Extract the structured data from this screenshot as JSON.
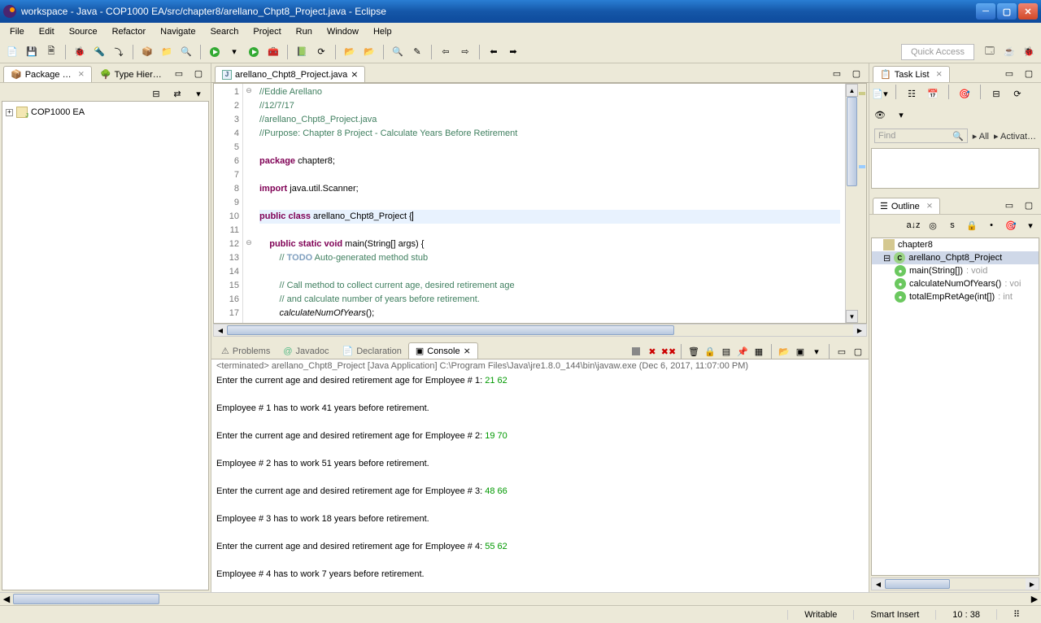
{
  "titlebar": {
    "title": "workspace - Java - COP1000 EA/src/chapter8/arellano_Chpt8_Project.java - Eclipse"
  },
  "menubar": [
    "File",
    "Edit",
    "Source",
    "Refactor",
    "Navigate",
    "Search",
    "Project",
    "Run",
    "Window",
    "Help"
  ],
  "quick_access": "Quick Access",
  "left_panel": {
    "package_tab": "Package …",
    "type_hier_tab": "Type Hier…",
    "project_name": "COP1000 EA"
  },
  "editor": {
    "tab_label": "arellano_Chpt8_Project.java",
    "lines": [
      {
        "n": 1,
        "html": "<span class='cm'>//Eddie Arellano</span>"
      },
      {
        "n": 2,
        "html": "<span class='cm'>//12/7/17</span>"
      },
      {
        "n": 3,
        "html": "<span class='cm'>//arellano_Chpt8_Project.java</span>"
      },
      {
        "n": 4,
        "html": "<span class='cm'>//Purpose: Chapter 8 Project - Calculate Years Before Retirement</span>"
      },
      {
        "n": 5,
        "html": ""
      },
      {
        "n": 6,
        "html": "<span class='kw'>package</span> chapter8;"
      },
      {
        "n": 7,
        "html": ""
      },
      {
        "n": 8,
        "html": "<span class='kw'>import</span> java.util.Scanner;"
      },
      {
        "n": 9,
        "html": ""
      },
      {
        "n": 10,
        "hl": true,
        "html": "<span class='kw'>public</span> <span class='kw'>class</span> arellano_Chpt8_Project {<span class='cursor'></span>"
      },
      {
        "n": 11,
        "html": ""
      },
      {
        "n": 12,
        "html": "    <span class='kw'>public</span> <span class='kw'>static</span> <span class='kw'>void</span> main(String[] args) {"
      },
      {
        "n": 13,
        "html": "        <span class='cm'>// </span><span class='todo'>TODO</span><span class='cm'> Auto-generated method stub</span>"
      },
      {
        "n": 14,
        "html": ""
      },
      {
        "n": 15,
        "html": "        <span class='cm'>// Call method to collect current age, desired retirement age</span>"
      },
      {
        "n": 16,
        "html": "        <span class='cm'>// and calculate number of years before retirement.</span>"
      },
      {
        "n": 17,
        "html": "        <span style='font-style:italic'>calculateNumOfYears</span>();"
      }
    ]
  },
  "console": {
    "tabs": {
      "problems": "Problems",
      "javadoc": "Javadoc",
      "declaration": "Declaration",
      "console": "Console"
    },
    "header": "<terminated> arellano_Chpt8_Project [Java Application] C:\\Program Files\\Java\\jre1.8.0_144\\bin\\javaw.exe (Dec 6, 2017, 11:07:00 PM)",
    "lines": [
      {
        "t": "Enter the current age and desired retirement age for Employee # 1: ",
        "i": "21 62"
      },
      {
        "t": ""
      },
      {
        "t": "Employee # 1 has to work 41 years before retirement."
      },
      {
        "t": ""
      },
      {
        "t": "Enter the current age and desired retirement age for Employee # 2: ",
        "i": "19 70"
      },
      {
        "t": ""
      },
      {
        "t": "Employee # 2 has to work 51 years before retirement."
      },
      {
        "t": ""
      },
      {
        "t": "Enter the current age and desired retirement age for Employee # 3: ",
        "i": "48 66"
      },
      {
        "t": ""
      },
      {
        "t": "Employee # 3 has to work 18 years before retirement."
      },
      {
        "t": ""
      },
      {
        "t": "Enter the current age and desired retirement age for Employee # 4: ",
        "i": "55 62"
      },
      {
        "t": ""
      },
      {
        "t": "Employee # 4 has to work 7 years before retirement."
      }
    ]
  },
  "task_list": {
    "tab": "Task List",
    "find_placeholder": "Find",
    "all_label": "All",
    "activate_label": "Activat…"
  },
  "outline": {
    "tab": "Outline",
    "items": [
      {
        "lvl": 1,
        "icon": "pkg",
        "label": "chapter8"
      },
      {
        "lvl": 1,
        "icon": "cls",
        "label": "arellano_Chpt8_Project",
        "sel": true
      },
      {
        "lvl": 2,
        "icon": "mth",
        "label": "main(String[])",
        "ret": " : void"
      },
      {
        "lvl": 2,
        "icon": "mth",
        "label": "calculateNumOfYears()",
        "ret": " : voi"
      },
      {
        "lvl": 2,
        "icon": "mth",
        "label": "totalEmpRetAge(int[])",
        "ret": " : int"
      }
    ]
  },
  "statusbar": {
    "writable": "Writable",
    "mode": "Smart Insert",
    "pos": "10 : 38"
  }
}
